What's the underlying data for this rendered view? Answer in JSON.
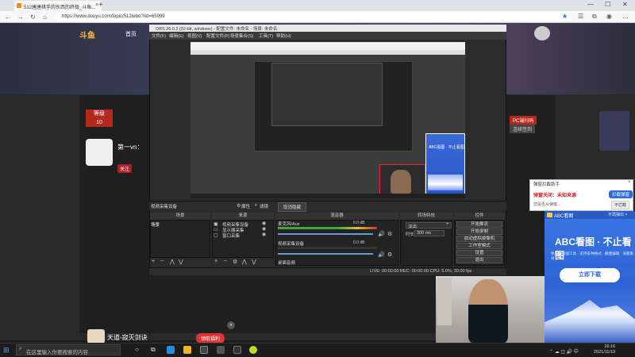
{
  "browser": {
    "tab_title": "512唐唐棋手的东西的终极_斗鱼...",
    "tab_close": "×",
    "new_tab": "+",
    "url": "https://www.douyu.com/topic/512tebo?rid=65999",
    "window_controls": [
      "—",
      "☐",
      "✕"
    ]
  },
  "douyu": {
    "logo": "斗鱼",
    "nav_home": "首页",
    "grade_label": "10",
    "grade_sub": "等级",
    "streamer_name": "第一vn：",
    "follow": "关注",
    "right_tag": "PC端扫码",
    "right_tag2": "连续签到",
    "bottom_user": "天道-寂灭剑诀",
    "collapse": "«",
    "promo": "领取福利"
  },
  "obs": {
    "title": "OBS 26.0.2 (32-bit, windows) - 配置文件: 未命名 - 场景: 未命名",
    "menu": [
      "文件(F)",
      "编辑(E)",
      "视图(V)",
      "配置文件(P)",
      "场景集合(S)",
      "工具(T)",
      "帮助(H)"
    ],
    "source_label": "视频采集设备",
    "properties": "属性",
    "filters": "滤镜",
    "restore": "取消隐藏",
    "docks": {
      "scenes": "场景",
      "sources": "来源",
      "mixer": "混音器",
      "transitions": "转场特效",
      "controls": "控件"
    },
    "scene_item": "场景",
    "sources": [
      {
        "label": "视频采集设备"
      },
      {
        "label": "显示器采集"
      },
      {
        "label": "窗口采集"
      }
    ],
    "mixer": [
      {
        "label": "麦克风/Aux",
        "db": "0.0 dB"
      },
      {
        "label": "视频采集设备",
        "db": "0.0 dB"
      },
      {
        "label": "桌面音频",
        "db": ""
      }
    ],
    "transition": "淡出",
    "duration_label": "时长",
    "duration": "300 ms",
    "controls": [
      "开始推流",
      "开始录制",
      "启动虚拟摄像机",
      "工作室模式",
      "设置",
      "退出"
    ],
    "status": "LIVE: 00:00:00   REC: 00:00:00   CPU: 5.0%, 30.00 fps",
    "inner_ad_title": "ABC看图 · 不止看图"
  },
  "popup": {
    "title": "弹窗拦截助手",
    "close": "×",
    "headline": "弹窗关闭：未知来源",
    "sub": "您是否从弹窗...",
    "btn_primary": "拦截弹窗",
    "btn_secondary": "不拦截"
  },
  "abc_ad": {
    "brand": "ABC看图",
    "controls": "不再弹出  ×",
    "title": "ABC看图 · 不止看图",
    "features": "免费版看图工具 · 支持多种格式 · 截图编辑 · 海量素材",
    "download": "立即下载"
  },
  "taskbar": {
    "search_placeholder": "在这里输入你要搜索的内容",
    "time": "16:16",
    "date": "2021/11/19"
  }
}
